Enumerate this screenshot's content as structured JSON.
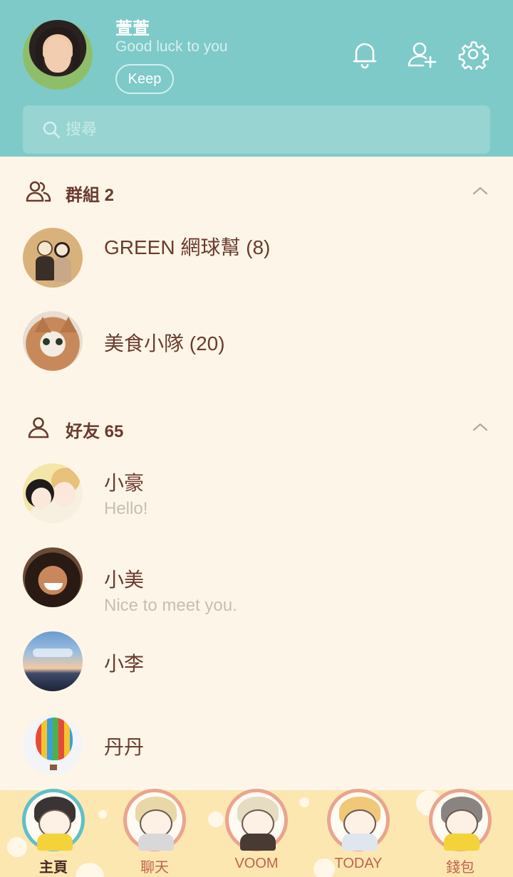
{
  "profile": {
    "name": "萱萱",
    "status": "Good luck to you",
    "keep_label": "Keep"
  },
  "header_icons": [
    "bell-icon",
    "add-friend-icon",
    "gear-icon"
  ],
  "search": {
    "placeholder": "搜尋",
    "value": ""
  },
  "groups": {
    "title": "群組 2",
    "items": [
      {
        "name": "GREEN 網球幫 (8)"
      },
      {
        "name": "美食小隊 (20)"
      }
    ]
  },
  "friends": {
    "title": "好友 65",
    "items": [
      {
        "name": "小豪",
        "status": "Hello!"
      },
      {
        "name": "小美",
        "status": "Nice to meet you."
      },
      {
        "name": "小李",
        "status": ""
      },
      {
        "name": "丹丹",
        "status": ""
      }
    ]
  },
  "nav": {
    "tabs": [
      {
        "label": "主頁",
        "active": true
      },
      {
        "label": "聊天"
      },
      {
        "label": "VOOM"
      },
      {
        "label": "TODAY"
      },
      {
        "label": "錢包"
      }
    ]
  },
  "colors": {
    "header_bg": "#7ecac8",
    "page_bg": "#fdf6e8",
    "text_primary": "#6b3a2e",
    "text_secondary": "#c9bcb4",
    "nav_bg": "#fce7b1",
    "nav_ring": "#eaa48e",
    "nav_ring_active": "#5ec0c8"
  }
}
